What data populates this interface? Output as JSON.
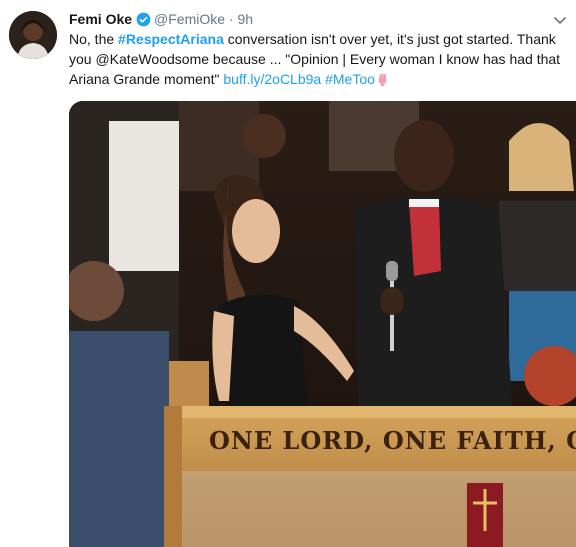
{
  "tweet": {
    "author_name": "Femi Oke",
    "author_handle": "@FemiOke",
    "separator": "·",
    "time_ago": "9h",
    "text_part1": "No, the ",
    "hashtag1": "#RespectAriana",
    "text_part2": " conversation isn't over yet, it's just got started. Thank you @KateWoodsome because ... \"Opinion | Every woman I know has had that Ariana Grande moment\" ",
    "link": "buff.ly/2oCLb9a",
    "hashtag2": "#MeToo",
    "emoji_icon": "raised-fist-emoji-icon"
  },
  "photo": {
    "sign_text": "ONE LORD, ONE FAITH, ONE BA"
  },
  "colors": {
    "link": "#1da1f2",
    "secondary_text": "#657786",
    "verified_badge": "#1da1f2",
    "primary_text": "#14171a"
  }
}
